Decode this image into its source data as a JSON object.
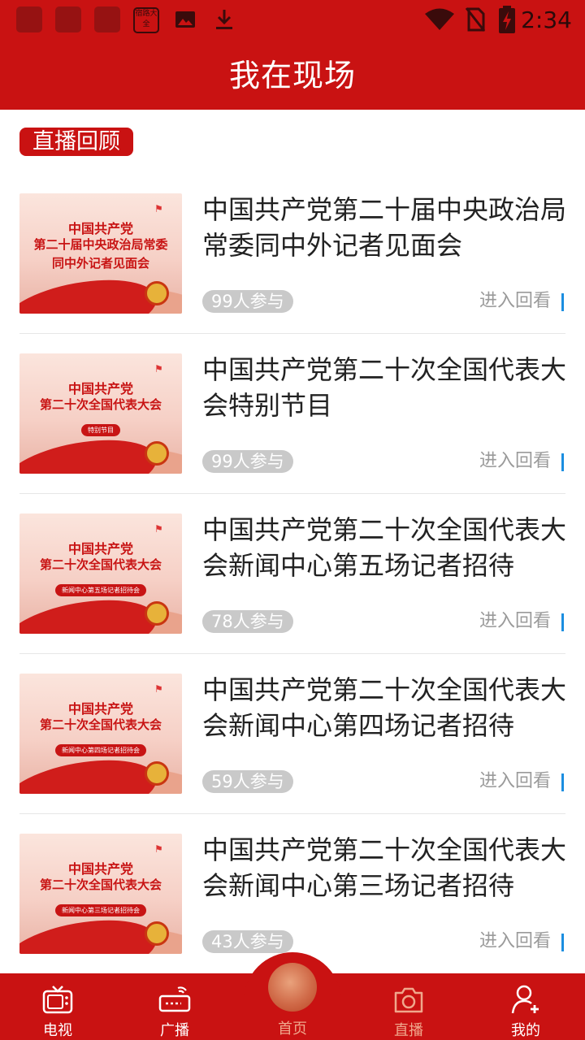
{
  "status_bar": {
    "time": "2:34",
    "app_icon_text": "宿路大全",
    "icons": [
      "notification-icon",
      "notification-icon",
      "notification-icon",
      "app-icon",
      "image-icon",
      "download-icon",
      "wifi-icon",
      "no-sim-icon",
      "battery-charging-icon"
    ]
  },
  "header": {
    "title": "我在现场"
  },
  "section": {
    "tag": "直播回顾"
  },
  "items": [
    {
      "title": "中国共产党第二十届中央政治局常委同中外记者见面会",
      "thumb_lines": [
        "中国共产党",
        "第二十届中央政治局常委",
        "同中外记者见面会"
      ],
      "thumb_badge": "",
      "count": "99人参与",
      "action": "进入回看"
    },
    {
      "title": "中国共产党第二十次全国代表大会特别节目",
      "thumb_lines": [
        "中国共产党",
        "第二十次全国代表大会",
        ""
      ],
      "thumb_badge": "特别节目",
      "count": "99人参与",
      "action": "进入回看"
    },
    {
      "title": "中国共产党第二十次全国代表大会新闻中心第五场记者招待",
      "thumb_lines": [
        "中国共产党",
        "第二十次全国代表大会",
        ""
      ],
      "thumb_badge": "新闻中心第五场记者招待会",
      "count": "78人参与",
      "action": "进入回看"
    },
    {
      "title": "中国共产党第二十次全国代表大会新闻中心第四场记者招待",
      "thumb_lines": [
        "中国共产党",
        "第二十次全国代表大会",
        ""
      ],
      "thumb_badge": "新闻中心第四场记者招待会",
      "count": "59人参与",
      "action": "进入回看"
    },
    {
      "title": "中国共产党第二十次全国代表大会新闻中心第三场记者招待",
      "thumb_lines": [
        "中国共产党",
        "第二十次全国代表大会",
        ""
      ],
      "thumb_badge": "新闻中心第三场记者招待会",
      "count": "43人参与",
      "action": "进入回看"
    }
  ],
  "bottom_nav": {
    "tv": "电视",
    "radio": "广播",
    "home": "首页",
    "live": "直播",
    "mine": "我的",
    "active": "home"
  },
  "colors": {
    "brand_red": "#c91212",
    "accent_blue": "#1b8ee0",
    "muted_peach": "#f0a78c"
  }
}
